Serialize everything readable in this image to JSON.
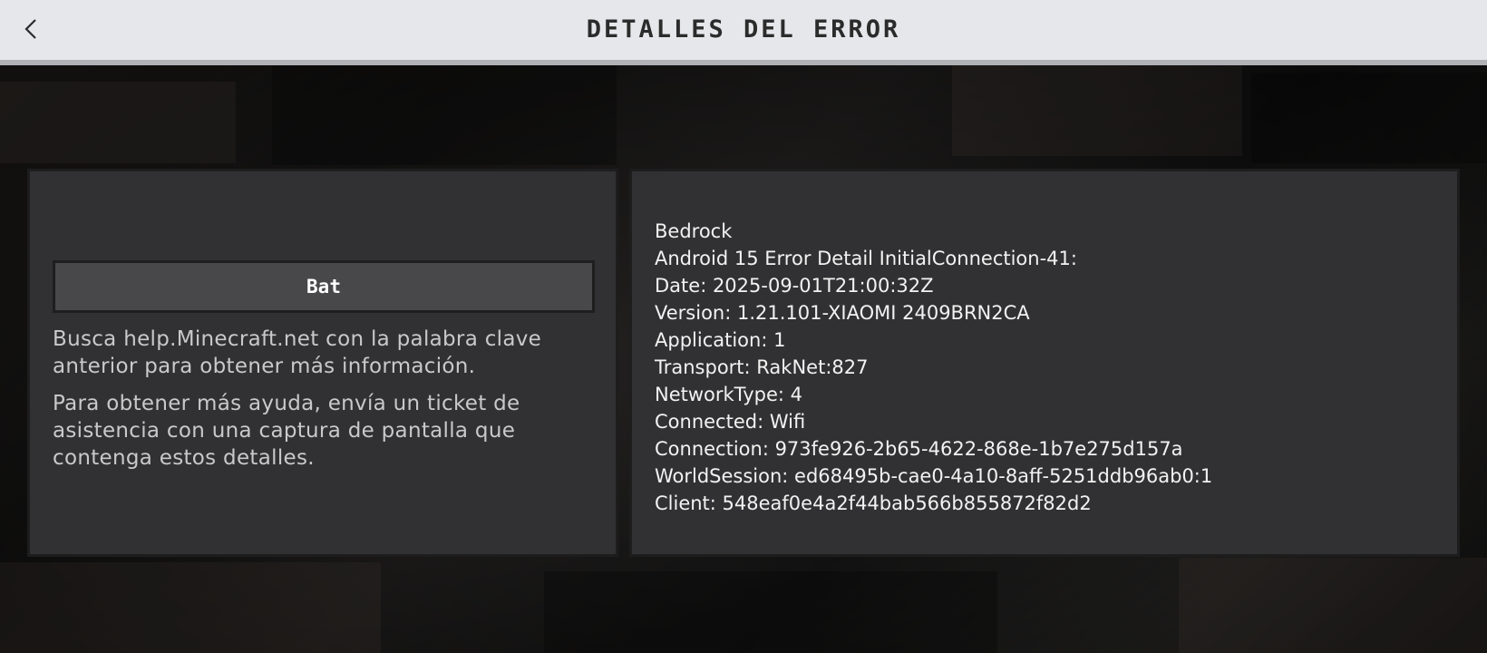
{
  "header": {
    "title": "DETALLES DEL ERROR",
    "back_icon": "chevron-left-icon"
  },
  "left_panel": {
    "code": "Bat",
    "help_1": "Busca help.Minecraft.net con la palabra clave anterior para obtener más información.",
    "help_2": "Para obtener más ayuda, envía un ticket de asistencia con una captura de pantalla que contenga estos detalles."
  },
  "right_panel": {
    "lines": [
      "Bedrock",
      "Android 15 Error Detail InitialConnection-41:",
      "Date: 2025-09-01T21:00:32Z",
      "Version: 1.21.101-XIAOMI 2409BRN2CA",
      "Application: 1",
      "Transport: RakNet:827",
      "NetworkType: 4",
      "Connected: Wifi",
      "Connection: 973fe926-2b65-4622-868e-1b7e275d157a",
      "WorldSession: ed68495b-cae0-4a10-8aff-5251ddb96ab0:1",
      "Client: 548eaf0e4a2f44bab566b855872f82d2"
    ]
  }
}
